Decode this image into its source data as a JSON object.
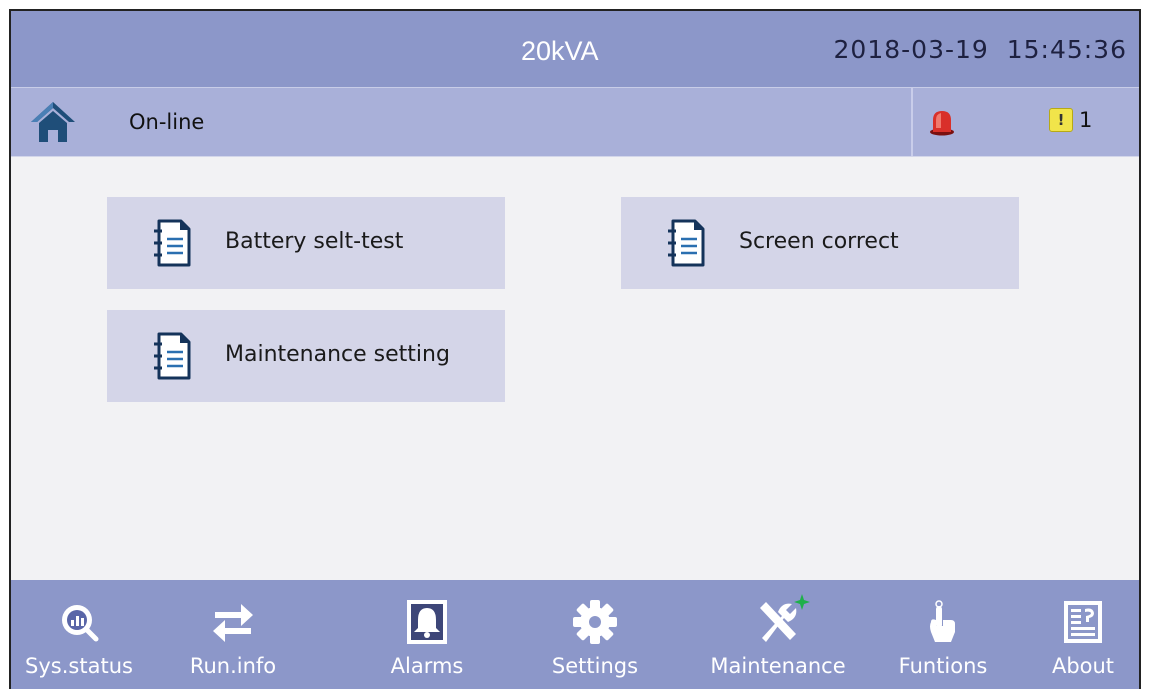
{
  "header": {
    "model": "20kVA",
    "datetime": "2018-03-19  15:45:36"
  },
  "status": {
    "mode": "On-line",
    "warning_count": "1",
    "warning_symbol": "!"
  },
  "menu": {
    "items": [
      {
        "label": "Battery selt-test",
        "icon": "document-icon"
      },
      {
        "label": "Screen correct",
        "icon": "document-icon"
      },
      {
        "label": "Maintenance setting",
        "icon": "document-icon"
      }
    ]
  },
  "nav": {
    "items": [
      {
        "label": "Sys.status",
        "icon": "magnifier-chart-icon"
      },
      {
        "label": "Run.info",
        "icon": "swap-arrows-icon"
      },
      {
        "label": "Alarms",
        "icon": "bell-icon"
      },
      {
        "label": "Settings",
        "icon": "gear-icon"
      },
      {
        "label": "Maintenance",
        "icon": "tools-icon"
      },
      {
        "label": "Funtions",
        "icon": "hand-pointer-icon"
      },
      {
        "label": "About",
        "icon": "info-document-icon"
      }
    ]
  },
  "colors": {
    "bar": "#8c97c9",
    "status_bar": "#a9b0d9",
    "button_bg": "#d4d5e8",
    "home_icon": "#1f4e79"
  }
}
